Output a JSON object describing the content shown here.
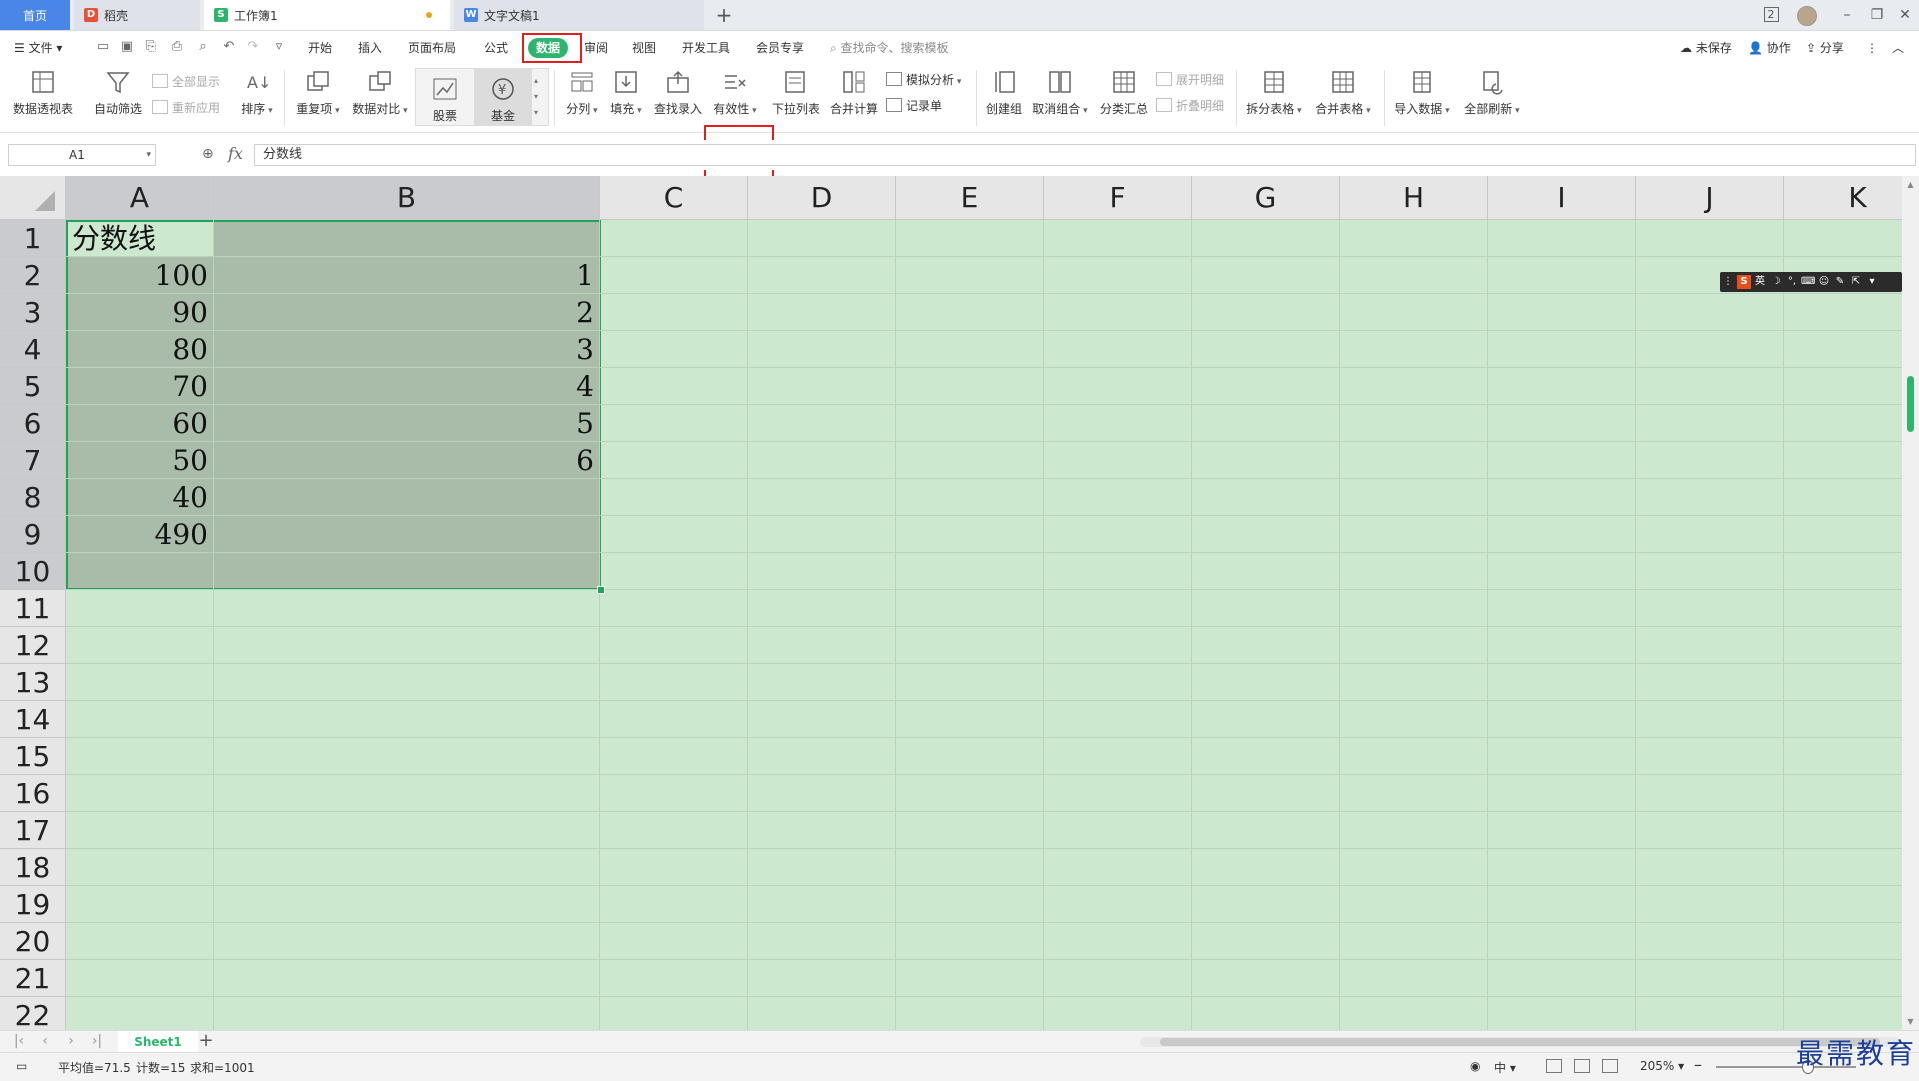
{
  "tabs": [
    {
      "label": "首页",
      "type": "home"
    },
    {
      "label": "稻壳",
      "type": "daoke"
    },
    {
      "label": "工作簿1",
      "type": "workbook",
      "modified": true
    },
    {
      "label": "文字文稿1",
      "type": "document"
    }
  ],
  "window_controls": {
    "badge": "2"
  },
  "menu": {
    "file_label": "文件",
    "items": [
      "开始",
      "插入",
      "页面布局",
      "公式",
      "数据",
      "审阅",
      "视图",
      "开发工具",
      "会员专享"
    ],
    "active": "数据",
    "search_placeholder": "查找命令、搜索模板",
    "right": {
      "unsaved": "未保存",
      "collab": "协作",
      "share": "分享"
    }
  },
  "ribbon": {
    "pivot": "数据透视表",
    "autofilter": "自动筛选",
    "show_all": "全部显示",
    "reapply": "重新应用",
    "sort": "排序",
    "duplicates": "重复项",
    "compare": "数据对比",
    "stock": "股票",
    "fund": "基金",
    "split": "分列",
    "fill": "填充",
    "lookup": "查找录入",
    "validity": "有效性",
    "dropdown": "下拉列表",
    "consolidate": "合并计算",
    "whatif": "模拟分析",
    "record": "记录单",
    "group": "创建组",
    "ungroup": "取消组合",
    "subtotal": "分类汇总",
    "expand": "展开明细",
    "collapse": "折叠明细",
    "split_table": "拆分表格",
    "merge_table": "合并表格",
    "import": "导入数据",
    "refresh_all": "全部刷新"
  },
  "formula_bar": {
    "name_box": "A1",
    "fx": "fx",
    "content": "分数线"
  },
  "sheet": {
    "columns": [
      "A",
      "B",
      "C",
      "D",
      "E",
      "F",
      "G",
      "H",
      "I",
      "J",
      "K"
    ],
    "rows": [
      "1",
      "2",
      "3",
      "4",
      "5",
      "6",
      "7",
      "8",
      "9",
      "10",
      "11",
      "12",
      "13",
      "14",
      "15",
      "16",
      "17",
      "18",
      "19",
      "20",
      "21",
      "22"
    ],
    "A1": "分数线",
    "col_a": [
      "100",
      "90",
      "80",
      "70",
      "60",
      "50",
      "40",
      "490"
    ],
    "col_b": [
      "1",
      "2",
      "3",
      "4",
      "5",
      "6"
    ],
    "selection": "A1:B10"
  },
  "sheet_tabs": {
    "active": "Sheet1"
  },
  "status": {
    "average": "平均值=71.5",
    "count": "计数=15",
    "sum": "求和=1001",
    "input_mode": "中",
    "zoom": "205%"
  },
  "watermark": "最需教育",
  "colors": {
    "accent_green": "#2db56d",
    "highlight_red": "#e02020",
    "grid_bg": "#cce8cf",
    "selection_border": "#22a35a"
  }
}
